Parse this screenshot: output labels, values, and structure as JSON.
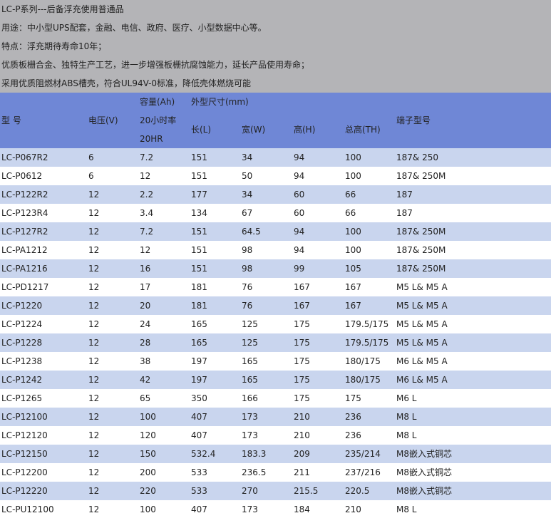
{
  "intro": [
    "LC-P系列---后备浮充使用普通品",
    "用途：中小型UPS配套，金融、电信、政府、医疗、小型数据中心等。",
    "特点：浮充期待寿命10年；",
    "优质板栅合金、独特生产工艺，进一步增强板栅抗腐蚀能力，延长产品使用寿命；",
    "采用优质阻燃材ABS槽壳，符合UL94V-0标准，降低壳体燃烧可能"
  ],
  "header": {
    "model": "型  号",
    "voltage": "电压(V)",
    "capacity": "容量(Ah)",
    "capacity_sub1": "20小时率",
    "capacity_sub2": "20HR",
    "dimensions": "外型尺寸(mm)",
    "length": "长(L)",
    "width": "宽(W)",
    "height": "高(H)",
    "total_height": "总高(TH)",
    "terminal": "端子型号"
  },
  "rows": [
    {
      "model": "LC-P067R2",
      "voltage": "6",
      "capacity": "7.2",
      "length": "151",
      "width": "34",
      "height": "94",
      "total_height": "100",
      "terminal": "187& 250"
    },
    {
      "model": "LC-P0612",
      "voltage": "6",
      "capacity": "12",
      "length": "151",
      "width": "50",
      "height": "94",
      "total_height": "100",
      "terminal": "187& 250M"
    },
    {
      "model": "LC-P122R2",
      "voltage": "12",
      "capacity": "2.2",
      "length": "177",
      "width": "34",
      "height": "60",
      "total_height": "66",
      "terminal": "187"
    },
    {
      "model": "LC-P123R4",
      "voltage": "12",
      "capacity": "3.4",
      "length": "134",
      "width": "67",
      "height": "60",
      "total_height": "66",
      "terminal": "187"
    },
    {
      "model": "LC-P127R2",
      "voltage": "12",
      "capacity": "7.2",
      "length": "151",
      "width": "64.5",
      "height": "94",
      "total_height": "100",
      "terminal": "187& 250M"
    },
    {
      "model": "LC-PA1212",
      "voltage": "12",
      "capacity": "12",
      "length": "151",
      "width": "98",
      "height": "94",
      "total_height": "100",
      "terminal": "187& 250M"
    },
    {
      "model": "LC-PA1216",
      "voltage": "12",
      "capacity": "16",
      "length": "151",
      "width": "98",
      "height": "99",
      "total_height": "105",
      "terminal": "187& 250M"
    },
    {
      "model": "LC-PD1217",
      "voltage": "12",
      "capacity": "17",
      "length": "181",
      "width": "76",
      "height": "167",
      "total_height": "167",
      "terminal": "M5 L& M5 A"
    },
    {
      "model": "LC-P1220",
      "voltage": "12",
      "capacity": "20",
      "length": "181",
      "width": "76",
      "height": "167",
      "total_height": "167",
      "terminal": "M5 L& M5 A"
    },
    {
      "model": "LC-P1224",
      "voltage": "12",
      "capacity": "24",
      "length": "165",
      "width": "125",
      "height": "175",
      "total_height": "179.5/175",
      "terminal": "M5 L& M5 A"
    },
    {
      "model": "LC-P1228",
      "voltage": "12",
      "capacity": "28",
      "length": "165",
      "width": "125",
      "height": "175",
      "total_height": "179.5/175",
      "terminal": "M5 L& M5 A"
    },
    {
      "model": "LC-P1238",
      "voltage": "12",
      "capacity": "38",
      "length": "197",
      "width": "165",
      "height": "175",
      "total_height": "180/175",
      "terminal": "M6 L& M5 A"
    },
    {
      "model": "LC-P1242",
      "voltage": "12",
      "capacity": "42",
      "length": "197",
      "width": "165",
      "height": "175",
      "total_height": "180/175",
      "terminal": "M6 L& M5 A"
    },
    {
      "model": "LC-P1265",
      "voltage": "12",
      "capacity": "65",
      "length": "350",
      "width": "166",
      "height": "175",
      "total_height": "175",
      "terminal": "M6 L"
    },
    {
      "model": "LC-P12100",
      "voltage": "12",
      "capacity": "100",
      "length": "407",
      "width": "173",
      "height": "210",
      "total_height": "236",
      "terminal": "M8 L"
    },
    {
      "model": "LC-P12120",
      "voltage": "12",
      "capacity": "120",
      "length": "407",
      "width": "173",
      "height": "210",
      "total_height": "236",
      "terminal": "M8 L"
    },
    {
      "model": "LC-P12150",
      "voltage": "12",
      "capacity": "150",
      "length": "532.4",
      "width": "183.3",
      "height": "209",
      "total_height": "235/214",
      "terminal": "M8嵌入式铜芯"
    },
    {
      "model": "LC-P12200",
      "voltage": "12",
      "capacity": "200",
      "length": "533",
      "width": "236.5",
      "height": "211",
      "total_height": "237/216",
      "terminal": "M8嵌入式铜芯"
    },
    {
      "model": "LC-P12220",
      "voltage": "12",
      "capacity": "220",
      "length": "533",
      "width": "270",
      "height": "215.5",
      "total_height": "220.5",
      "terminal": "M8嵌入式铜芯"
    },
    {
      "model": "LC-PU12100",
      "voltage": "12",
      "capacity": "100",
      "length": "407",
      "width": "173",
      "height": "184",
      "total_height": "210",
      "terminal": "M8 L"
    }
  ]
}
